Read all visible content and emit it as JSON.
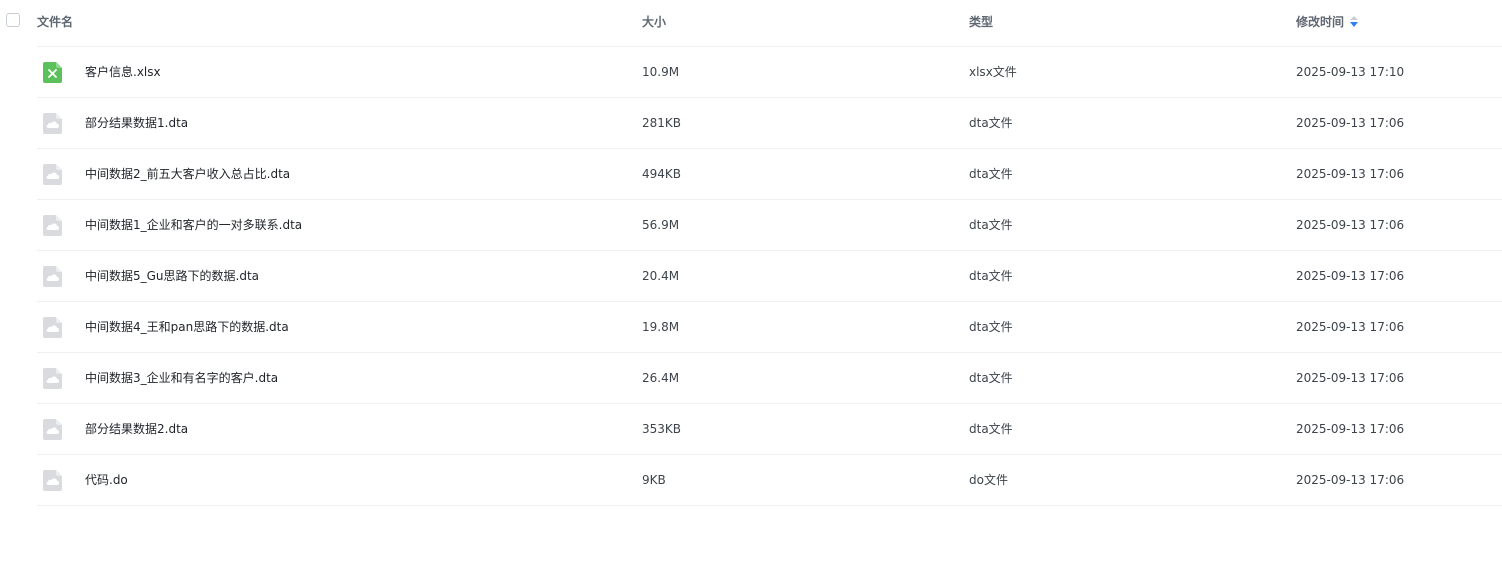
{
  "header": {
    "name_label": "文件名",
    "size_label": "大小",
    "type_label": "类型",
    "time_label": "修改时间"
  },
  "colors": {
    "xlsx_icon": "#5cc15a",
    "generic_icon": "#d9dbdf",
    "sort_active": "#2f80ed"
  },
  "files": [
    {
      "icon": "excel-file-icon",
      "name": "客户信息.xlsx",
      "size": "10.9M",
      "type": "xlsx文件",
      "time": "2025-09-13 17:10"
    },
    {
      "icon": "cloud-file-icon",
      "name": "部分结果数据1.dta",
      "size": "281KB",
      "type": "dta文件",
      "time": "2025-09-13 17:06"
    },
    {
      "icon": "cloud-file-icon",
      "name": "中间数据2_前五大客户收入总占比.dta",
      "size": "494KB",
      "type": "dta文件",
      "time": "2025-09-13 17:06"
    },
    {
      "icon": "cloud-file-icon",
      "name": "中间数据1_企业和客户的一对多联系.dta",
      "size": "56.9M",
      "type": "dta文件",
      "time": "2025-09-13 17:06"
    },
    {
      "icon": "cloud-file-icon",
      "name": "中间数据5_Gu思路下的数据.dta",
      "size": "20.4M",
      "type": "dta文件",
      "time": "2025-09-13 17:06"
    },
    {
      "icon": "cloud-file-icon",
      "name": "中间数据4_王和pan思路下的数据.dta",
      "size": "19.8M",
      "type": "dta文件",
      "time": "2025-09-13 17:06"
    },
    {
      "icon": "cloud-file-icon",
      "name": "中间数据3_企业和有名字的客户.dta",
      "size": "26.4M",
      "type": "dta文件",
      "time": "2025-09-13 17:06"
    },
    {
      "icon": "cloud-file-icon",
      "name": "部分结果数据2.dta",
      "size": "353KB",
      "type": "dta文件",
      "time": "2025-09-13 17:06"
    },
    {
      "icon": "cloud-file-icon",
      "name": "代码.do",
      "size": "9KB",
      "type": "do文件",
      "time": "2025-09-13 17:06"
    }
  ]
}
